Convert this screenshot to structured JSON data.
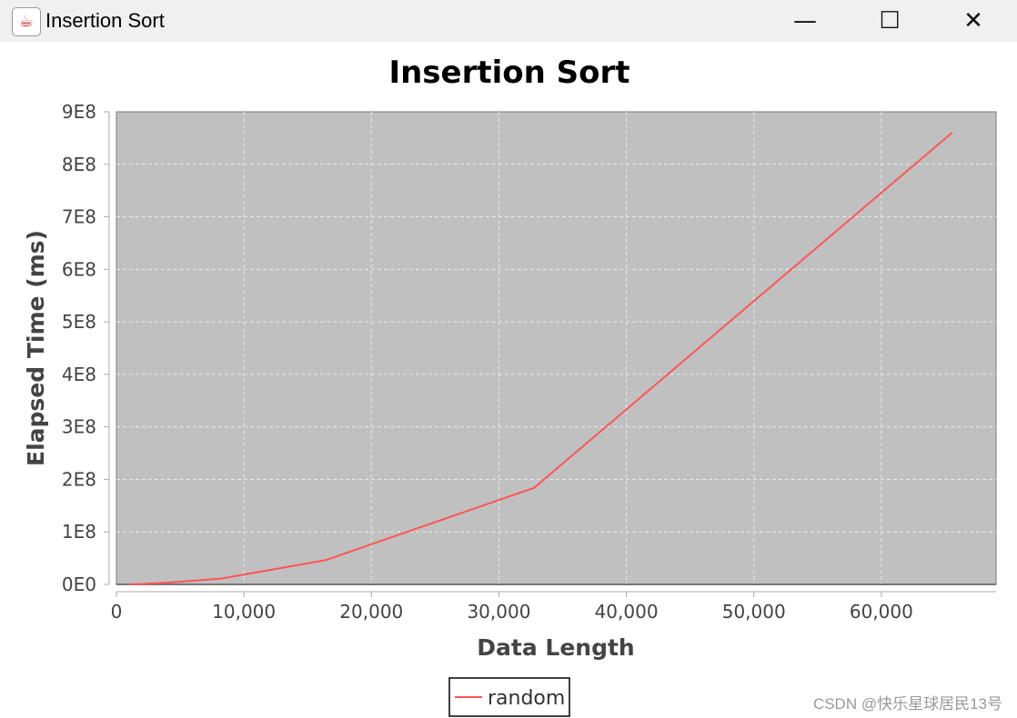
{
  "window": {
    "title": "Insertion Sort",
    "icon": "java-icon",
    "controls": [
      "minimize",
      "maximize",
      "close"
    ]
  },
  "chart_data": {
    "type": "line",
    "title": "Insertion Sort",
    "xlabel": "Data Length",
    "ylabel": "Elapsed Time (ms)",
    "xlim": [
      0,
      69000
    ],
    "ylim": [
      0,
      900000000
    ],
    "xticks": [
      0,
      10000,
      20000,
      30000,
      40000,
      50000,
      60000
    ],
    "xtick_labels": [
      "0",
      "10,000",
      "20,000",
      "30,000",
      "40,000",
      "50,000",
      "60,000"
    ],
    "yticks": [
      0,
      100000000,
      200000000,
      300000000,
      400000000,
      500000000,
      600000000,
      700000000,
      800000000,
      900000000
    ],
    "ytick_labels": [
      "0E0",
      "1E8",
      "2E8",
      "3E8",
      "4E8",
      "5E8",
      "6E8",
      "7E8",
      "8E8",
      "9E8"
    ],
    "grid": true,
    "background": "#c0c0c0",
    "legend": "bottom",
    "series": [
      {
        "name": "random",
        "color": "#ff5555",
        "x": [
          1024,
          2048,
          4096,
          8192,
          16384,
          32768,
          65536
        ],
        "y": [
          220000,
          900000,
          3500000,
          11000000,
          46000000,
          184000000,
          860000000
        ]
      }
    ]
  },
  "watermark": "CSDN @快乐星球居民13号"
}
